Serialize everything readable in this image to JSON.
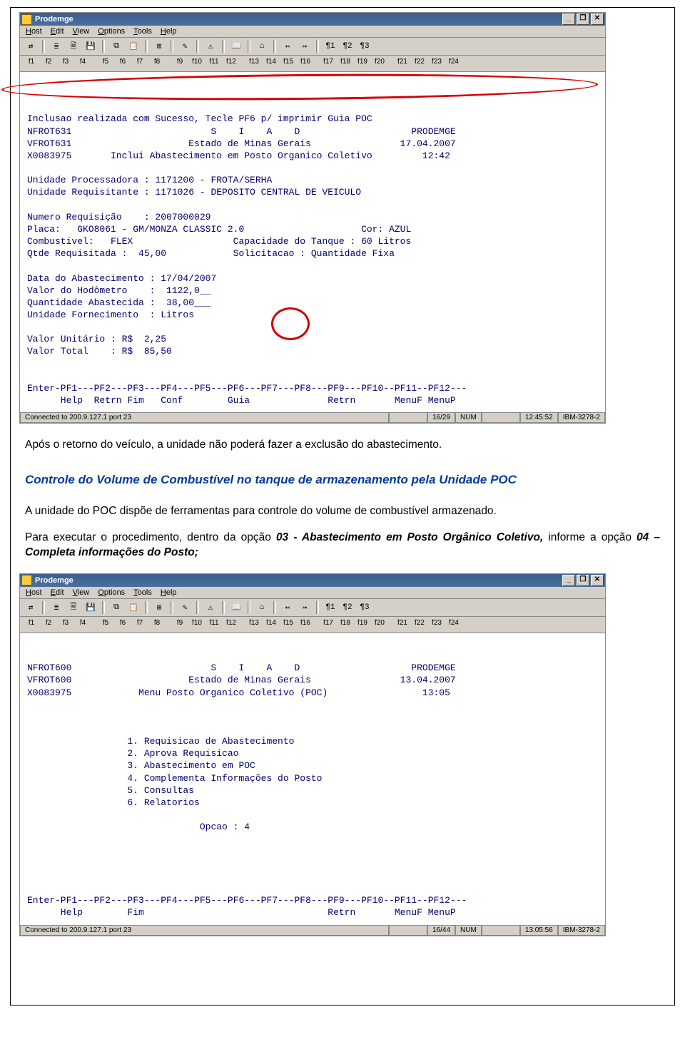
{
  "app_title": "Prodemge",
  "menu": {
    "host": "Host",
    "edit": "Edit",
    "view": "View",
    "options": "Options",
    "tools": "Tools",
    "help": "Help"
  },
  "fkeys_top1": [
    "f1",
    "f2",
    "f3",
    "f4",
    "f5",
    "f6",
    "f7",
    "f8",
    "f9",
    "f10",
    "f11",
    "f12",
    "f13",
    "f14",
    "f15",
    "f16",
    "f17",
    "f18",
    "f19",
    "f20",
    "f21",
    "f22",
    "f23",
    "f24"
  ],
  "term1": {
    "success": "Inclusao realizada com Sucesso, Tecle PF6 p/ imprimir Guia POC",
    "l1": "NFROT631                         S    I    A    D                    PRODEMGE",
    "l2": "VFROT631                     Estado de Minas Gerais                17.04.2007",
    "l3": "X0083975       Inclui Abastecimento em Posto Organico Coletivo         12:42",
    "proc": "Unidade Processadora : 1171200 - FROTA/SERHA",
    "req": "Unidade Requisitante : 1171026 - DEPOSITO CENTRAL DE VEICULO",
    "numreq": "Numero Requisição    : 2007000029",
    "placa": "Placa:   GKO8061 - GM/MONZA CLASSIC 2.0                     Cor: AZUL",
    "comb": "Combustivel:   FLEX                  Capacidade do Tanque : 60 Litros",
    "qtde": "Qtde Requisitada :  45,00            Solicitacao : Quantidade Fixa",
    "dataab": "Data do Abastecimento : 17/04/2007",
    "hod": "Valor do Hodômetro    :  1122,0__",
    "qtab": "Quantidade Abastecida :  38,00___",
    "unf": "Unidade Fornecimento  : Litros",
    "vu": "Valor Unitário : R$  2,25",
    "vt": "Valor Total    : R$  85,50",
    "pfrow": "Enter-PF1---PF2---PF3---PF4---PF5---PF6---PF7---PF8---PF9---PF10--PF11--PF12---",
    "pflab": "      Help  Retrn Fim   Conf        Guia              Retrn       MenuF MenuP"
  },
  "status1": {
    "conn": "Connected to 200.9.127.1 port 23",
    "pos": "16/29",
    "num": "NUM",
    "time": "12:45:52",
    "emu": "IBM-3278-2"
  },
  "para1": "Após o retorno do veículo, a unidade não poderá fazer a exclusão do abastecimento.",
  "heading": "Controle do Volume de Combustível no tanque de armazenamento pela Unidade POC",
  "para2a": "A unidade do POC dispõe de ferramentas para controle do volume de combustível armazenado.",
  "para2b_pre": "Para executar o procedimento, dentro da opção ",
  "opt1": "03 - Abastecimento em Posto Orgânico Coletivo,",
  "para2b_mid": " informe a opção ",
  "opt2": "04 – Completa informações do Posto;",
  "term2": {
    "l1": "NFROT600                         S    I    A    D                    PRODEMGE",
    "l2": "VFROT600                     Estado de Minas Gerais                13.04.2007",
    "l3": "X0083975            Menu Posto Organico Coletivo (POC)                 13:05",
    "menu1": "                  1. Requisicao de Abastecimento",
    "menu2": "                  2. Aprova Requisicao",
    "menu3": "                  3. Abastecimento em POC",
    "menu4": "                  4. Complementa Informações do Posto",
    "menu5": "                  5. Consultas",
    "menu6": "                  6. Relatorios",
    "opcao": "                               Opcao : 4",
    "pfrow": "Enter-PF1---PF2---PF3---PF4---PF5---PF6---PF7---PF8---PF9---PF10--PF11--PF12---",
    "pflab": "      Help        Fim                                 Retrn       MenuF MenuP"
  },
  "status2": {
    "conn": "Connected to 200.9.127.1 port 23",
    "pos": "16/44",
    "num": "NUM",
    "time": "13:05:56",
    "emu": "IBM-3278-2"
  }
}
